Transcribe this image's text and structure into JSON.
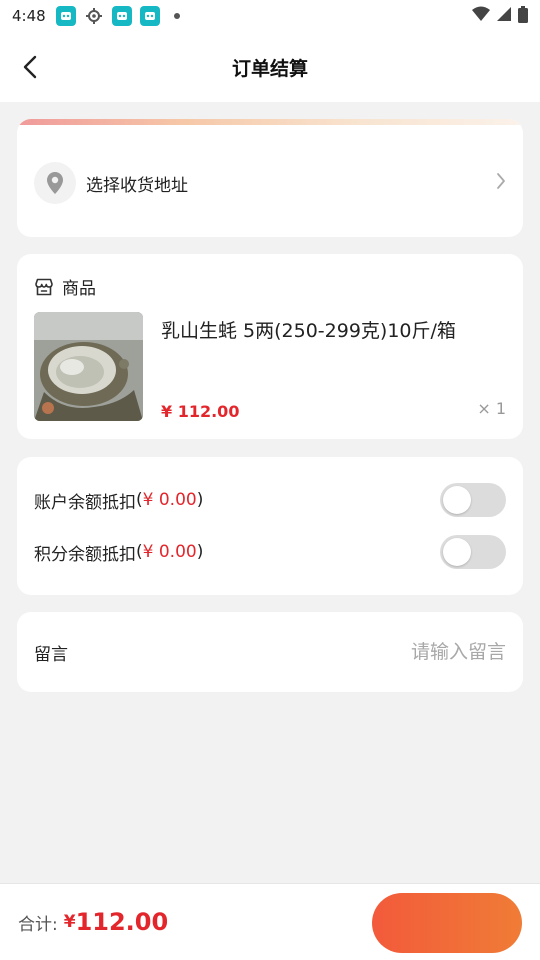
{
  "status_bar": {
    "time": "4:48"
  },
  "header": {
    "title": "订单结算"
  },
  "address": {
    "label": "选择收货地址"
  },
  "goods": {
    "section_label": "商品",
    "name": "乳山生蚝 5两(250-299克)10斤/箱",
    "price": "¥ 112.00",
    "quantity": "× 1"
  },
  "deductions": [
    {
      "label": "账户余额抵扣",
      "open": "(",
      "amount": "¥ 0.00",
      "close": ")",
      "enabled": false
    },
    {
      "label": "积分余额抵扣",
      "open": "(",
      "amount": "¥ 0.00",
      "close": ")",
      "enabled": false
    }
  ],
  "message": {
    "label": "留言",
    "placeholder": "请输入留言"
  },
  "footer": {
    "total_label": "合计:",
    "currency": "¥",
    "total_amount": "112.00",
    "submit_label": ""
  },
  "colors": {
    "accent_red": "#e3262c",
    "button_orange": "#f25a3b",
    "page_bg": "#f2f2f3"
  }
}
